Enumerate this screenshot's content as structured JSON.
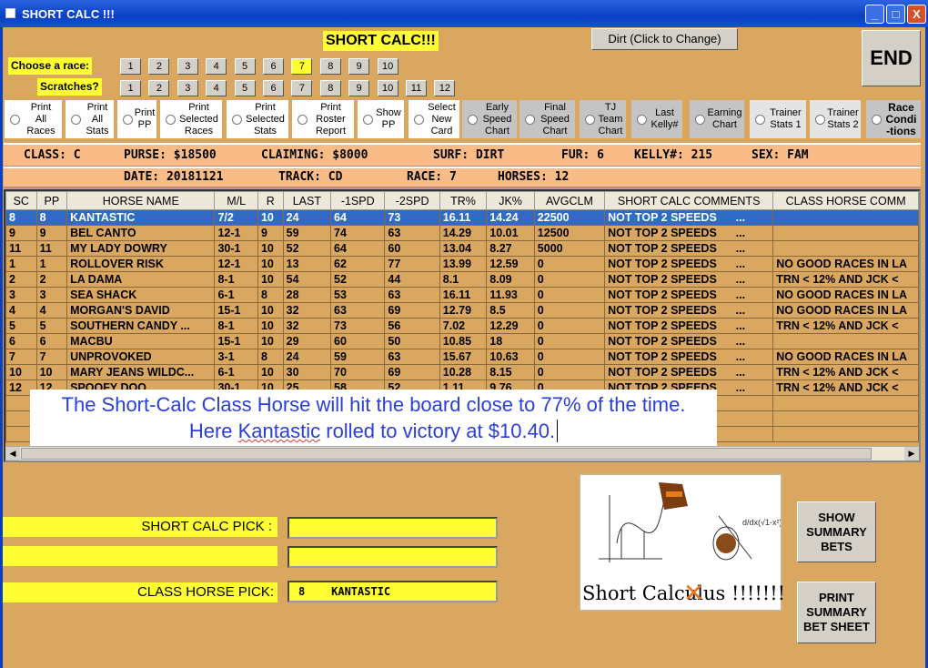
{
  "window": {
    "title": "SHORT CALC !!!",
    "controls": [
      "_",
      "□",
      "X"
    ]
  },
  "header": {
    "title": "SHORT CALC!!!",
    "surface_button": "Dirt (Click to Change)",
    "end_button": "END"
  },
  "race_picker": {
    "label": "Choose  a race:",
    "races": [
      "1",
      "2",
      "3",
      "4",
      "5",
      "6",
      "7",
      "8",
      "9",
      "10"
    ],
    "selected": "7"
  },
  "scratches": {
    "label": "Scratches?",
    "numbers": [
      "1",
      "2",
      "3",
      "4",
      "5",
      "6",
      "7",
      "8",
      "9",
      "10",
      "11",
      "12"
    ]
  },
  "options": [
    {
      "label": "Print\nAll\nRaces"
    },
    {
      "label": "Print\nAll\nStats"
    },
    {
      "label": "Print\nPP"
    },
    {
      "label": "Print\nSelected\nRaces"
    },
    {
      "label": "Print\nSelected\nStats"
    },
    {
      "label": "Print\nRoster\nReport"
    },
    {
      "label": "Show\nPP"
    },
    {
      "label": "Select\nNew\nCard"
    },
    {
      "label": "Early\nSpeed\nChart"
    },
    {
      "label": "Final\nSpeed\nChart"
    },
    {
      "label": "TJ\nTeam\nChart"
    },
    {
      "label": "Last\nKelly#"
    },
    {
      "label": "Earning\nChart"
    },
    {
      "label": "Trainer\nStats 1"
    },
    {
      "label": "Trainer\nStats 2"
    },
    {
      "label": "Race\nCondi\n-tions"
    }
  ],
  "race_info": {
    "class": "CLASS: C",
    "purse": "PURSE: $18500",
    "claiming": "CLAIMING: $8000",
    "surf": "SURF: DIRT",
    "fur": "FUR: 6",
    "kelly": "KELLY#: 215",
    "sex": "SEX: FAM",
    "date": "DATE: 20181121",
    "track": "TRACK: CD",
    "race": "RACE: 7",
    "horses": "HORSES: 12"
  },
  "table": {
    "columns": [
      "SC",
      "PP",
      "HORSE NAME",
      "M/L",
      "R",
      "LAST",
      "-1SPD",
      "-2SPD",
      "TR%",
      "JK%",
      "AVGCLM",
      "SHORT CALC COMMENTS",
      "CLASS HORSE COMM"
    ],
    "rows": [
      [
        "8",
        "8",
        "KANTASTIC",
        "7/2",
        "10",
        "24",
        "64",
        "73",
        "16.11",
        "14.24",
        "22500",
        "NOT TOP 2 SPEEDS      ...",
        ""
      ],
      [
        "9",
        "9",
        "BEL CANTO",
        "12-1",
        "9",
        "59",
        "74",
        "63",
        "14.29",
        "10.01",
        "12500",
        "NOT TOP 2 SPEEDS      ...",
        ""
      ],
      [
        "11",
        "11",
        "MY LADY DOWRY",
        "30-1",
        "10",
        "52",
        "64",
        "60",
        "13.04",
        "8.27",
        "5000",
        "NOT TOP 2 SPEEDS      ...",
        ""
      ],
      [
        "1",
        "1",
        "ROLLOVER RISK",
        "12-1",
        "10",
        "13",
        "62",
        "77",
        "13.99",
        "12.59",
        "0",
        "NOT TOP 2 SPEEDS      ...",
        "NO GOOD RACES IN LA"
      ],
      [
        "2",
        "2",
        "LA DAMA",
        "8-1",
        "10",
        "54",
        "52",
        "44",
        "8.1",
        "8.09",
        "0",
        "NOT TOP 2 SPEEDS      ...",
        "TRN < 12% AND JCK <"
      ],
      [
        "3",
        "3",
        "SEA SHACK",
        "6-1",
        "8",
        "28",
        "53",
        "63",
        "16.11",
        "11.93",
        "0",
        "NOT TOP 2 SPEEDS      ...",
        "NO GOOD RACES IN LA"
      ],
      [
        "4",
        "4",
        "MORGAN'S DAVID",
        "15-1",
        "10",
        "32",
        "63",
        "69",
        "12.79",
        "8.5",
        "0",
        "NOT TOP 2 SPEEDS      ...",
        "NO GOOD RACES IN LA"
      ],
      [
        "5",
        "5",
        "SOUTHERN CANDY ...",
        "8-1",
        "10",
        "32",
        "73",
        "56",
        "7.02",
        "12.29",
        "0",
        "NOT TOP 2 SPEEDS      ...",
        "TRN < 12% AND JCK <"
      ],
      [
        "6",
        "6",
        "MACBU",
        "15-1",
        "10",
        "29",
        "60",
        "50",
        "10.85",
        "18",
        "0",
        "NOT TOP 2 SPEEDS      ...",
        ""
      ],
      [
        "7",
        "7",
        "UNPROVOKED",
        "3-1",
        "8",
        "24",
        "59",
        "63",
        "15.67",
        "10.63",
        "0",
        "NOT TOP 2 SPEEDS      ...",
        "NO GOOD RACES IN LA"
      ],
      [
        "10",
        "10",
        "MARY JEANS WILDC...",
        "6-1",
        "10",
        "30",
        "70",
        "69",
        "10.28",
        "8.15",
        "0",
        "NOT TOP 2 SPEEDS      ...",
        "TRN < 12% AND JCK <"
      ],
      [
        "12",
        "12",
        "SPOOFY DOO",
        "30-1",
        "10",
        "25",
        "58",
        "52",
        "1.11",
        "9.76",
        "0",
        "NOT TOP 2 SPEEDS      ...",
        "TRN < 12% AND JCK <"
      ]
    ],
    "selected_row": 0
  },
  "caption": {
    "line1": "The Short-Calc Class Horse will hit the board close to 77% of the time.",
    "line2_pre": "Here ",
    "line2_name": "Kantastic",
    "line2_post": " rolled to victory at $10.40."
  },
  "picks": {
    "short_calc_label": "SHORT CALC PICK :",
    "short_calc_value": "",
    "second_value": "",
    "class_horse_label": "CLASS HORSE PICK:",
    "class_horse_value": "8    KANTASTIC"
  },
  "logo": {
    "text": "Short Calculus !!!!!!!"
  },
  "buttons": {
    "show_summary": "SHOW SUMMARY BETS",
    "print_summary": "PRINT SUMMARY BET SHEET"
  },
  "colors": {
    "background": "#D9A760",
    "highlight": "#FFFF33",
    "info_bar": "#F9BC86",
    "selection": "#316AC5",
    "caption_text": "#2B3ED6"
  }
}
